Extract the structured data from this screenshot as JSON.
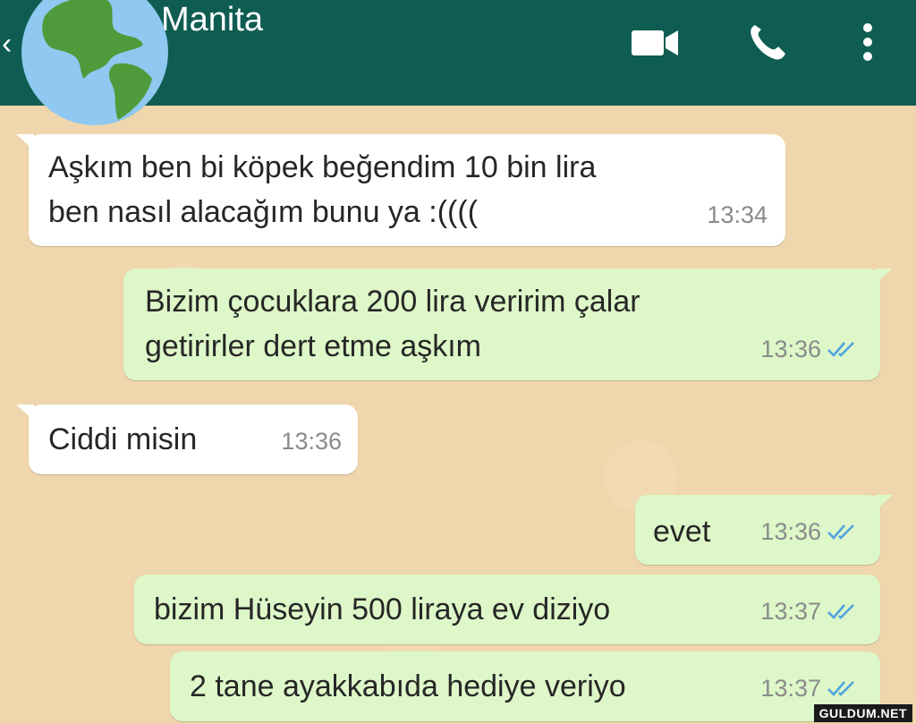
{
  "header": {
    "contact_name": "Manita",
    "back_icon": "arrow-left-icon",
    "avatar_icon": "globe-icon",
    "video_icon": "video-call-icon",
    "call_icon": "phone-icon",
    "menu_icon": "more-vertical-icon",
    "color": "#0f5d52"
  },
  "messages": [
    {
      "direction": "incoming",
      "lines": [
        "Aşkım ben bi köpek beğendim 10 bin lira",
        "ben nasıl alacağım bunu ya :(((("
      ],
      "time": "13:34"
    },
    {
      "direction": "outgoing",
      "lines": [
        "Bizim çocuklara 200 lira veririm çalar",
        "getirirler dert etme aşkım"
      ],
      "time": "13:36",
      "status": "read-ticks-icon"
    },
    {
      "direction": "incoming",
      "lines": [
        "Ciddi misin"
      ],
      "time": "13:36"
    },
    {
      "direction": "outgoing",
      "lines": [
        "evet"
      ],
      "time": "13:36",
      "status": "read-ticks-icon"
    },
    {
      "direction": "outgoing",
      "lines": [
        "bizim Hüseyin 500 liraya ev diziyo"
      ],
      "time": "13:37",
      "status": "read-ticks-icon"
    },
    {
      "direction": "outgoing",
      "lines": [
        "2 tane ayakkabıda hediye veriyo"
      ],
      "time": "13:37",
      "status": "read-ticks-icon"
    }
  ],
  "watermark": "GULDUM.NET",
  "colors": {
    "incoming": "#ffffff",
    "outgoing": "#ddf7c8",
    "ticks": "#4fa3e0",
    "wallpaper": "#efd6ac"
  }
}
